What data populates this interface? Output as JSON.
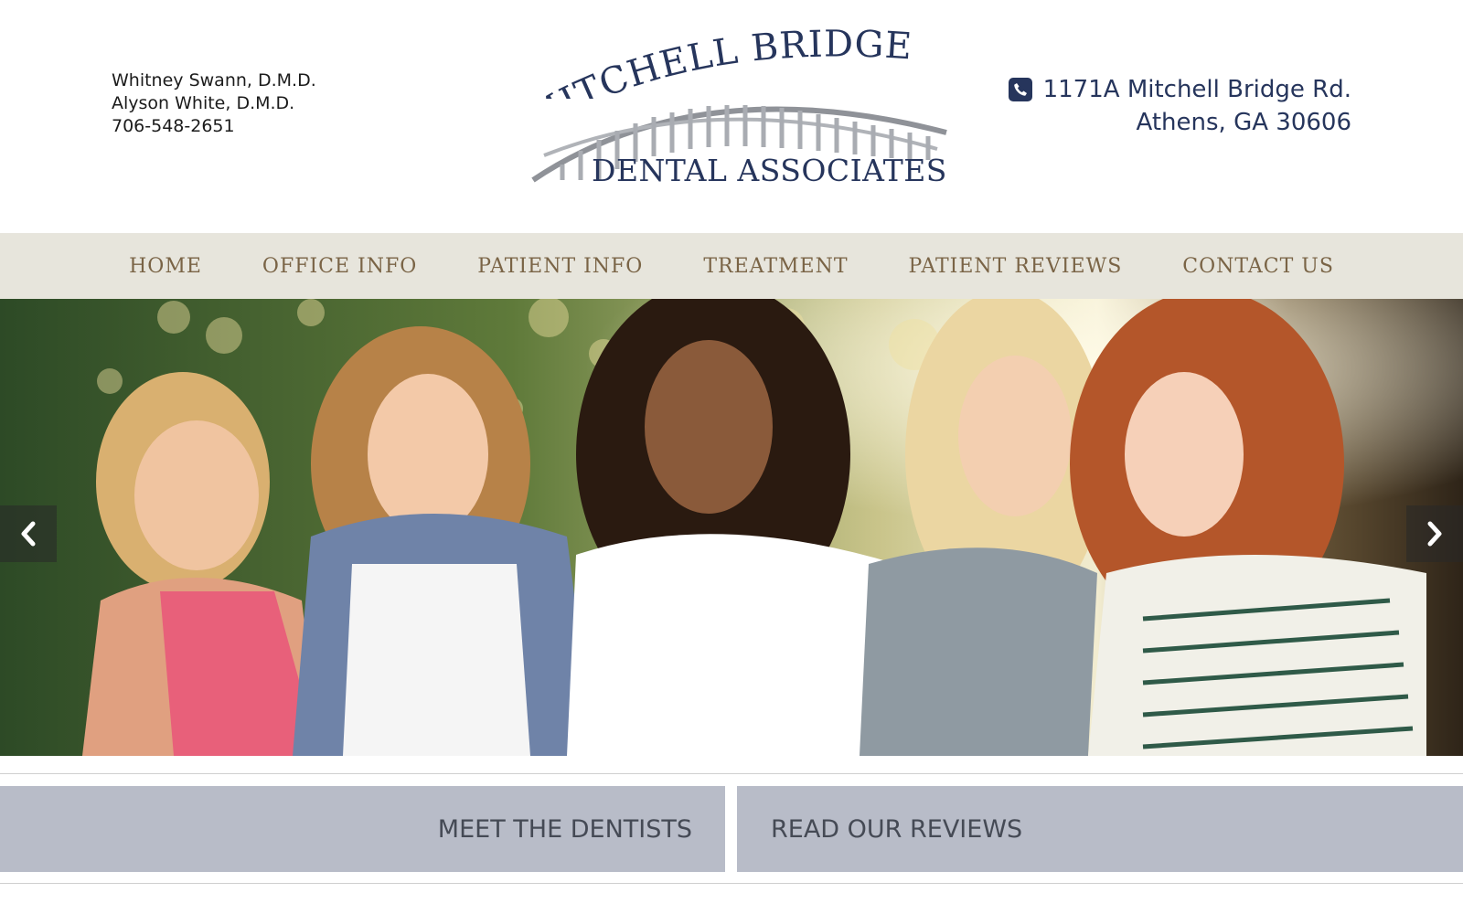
{
  "header": {
    "doctors": [
      "Whitney Swann, D.M.D.",
      "Alyson White, D.M.D."
    ],
    "phone": "706-548-2651",
    "logo": {
      "top_text": "MITCHELL BRIDGE",
      "bottom_text": "DENTAL ASSOCIATES"
    },
    "address": {
      "icon": "phone-icon",
      "line1": "1171A Mitchell Bridge Rd.",
      "line2": "Athens, GA 30606"
    }
  },
  "nav": {
    "items": [
      {
        "label": "HOME"
      },
      {
        "label": "OFFICE INFO"
      },
      {
        "label": "PATIENT INFO"
      },
      {
        "label": "TREATMENT"
      },
      {
        "label": "PATIENT REVIEWS"
      },
      {
        "label": "CONTACT US"
      }
    ]
  },
  "hero": {
    "prev_icon": "chevron-left-icon",
    "next_icon": "chevron-right-icon"
  },
  "cta": {
    "meet": "MEET THE DENTISTS",
    "reviews": "READ OUR REVIEWS"
  },
  "colors": {
    "brand_navy": "#26355c",
    "nav_bg": "#e7e5dc",
    "nav_text": "#7a6446",
    "cta_bg": "#b8bcc8"
  }
}
